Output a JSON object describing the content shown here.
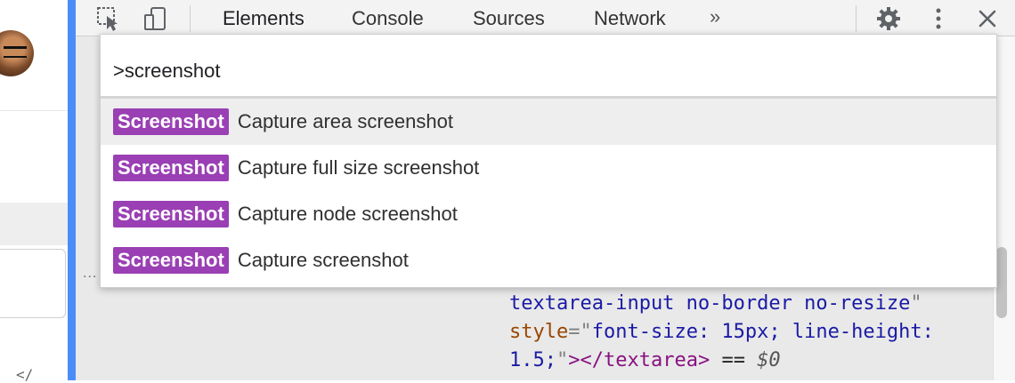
{
  "toolbar": {
    "tabs": [
      "Elements",
      "Console",
      "Sources",
      "Network"
    ],
    "more_tabs_label": "»"
  },
  "command_menu": {
    "query": ">screenshot",
    "items": [
      {
        "badge": "Screenshot",
        "title": "Capture area screenshot",
        "selected": true
      },
      {
        "badge": "Screenshot",
        "title": "Capture full size screenshot",
        "selected": false
      },
      {
        "badge": "Screenshot",
        "title": "Capture node screenshot",
        "selected": false
      },
      {
        "badge": "Screenshot",
        "title": "Capture screenshot",
        "selected": false
      }
    ],
    "badge_color": "#9a3fb4"
  },
  "elements_panel": {
    "ellipsis": "...",
    "line1": {
      "text": "textarea-input no-border no-resize",
      "quote": "\""
    },
    "line2": {
      "attr": "style",
      "eq": "=",
      "quote": "\"",
      "value": "font-size: 15px; line-height:"
    },
    "line3": {
      "value": "1.5;",
      "quote": "\"",
      "close_open": "></",
      "tag": "textarea",
      "close": ">",
      "eq": " == ",
      "dollar": "$0"
    }
  },
  "page_strip": {
    "bottom_text": "</"
  },
  "colors": {
    "accent_blue": "#4a8df8"
  }
}
